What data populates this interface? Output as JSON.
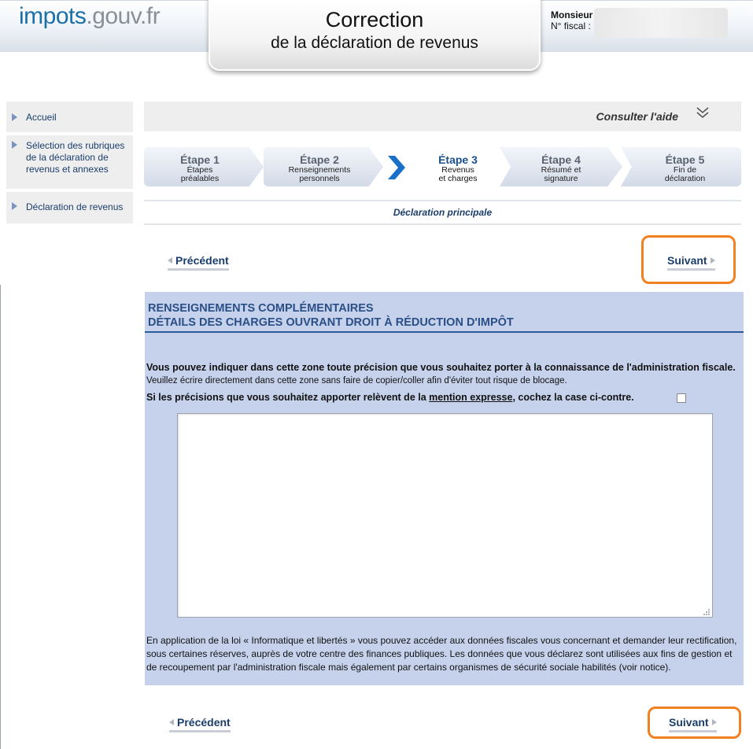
{
  "header": {
    "logo_part1": "impots",
    "logo_part2": ".gouv.fr",
    "title_line1": "Correction",
    "title_line2": "de la déclaration de revenus",
    "user_label": "Monsieur",
    "fiscal_label": "N° fiscal :"
  },
  "sidebar": {
    "items": [
      {
        "label": "Accueil"
      },
      {
        "label": "Sélection des rubriques de la déclaration de revenus et annexes"
      },
      {
        "label": "Déclaration de revenus"
      }
    ]
  },
  "help": {
    "label": "Consulter l'aide",
    "icon": "double-chevron-down-icon"
  },
  "steps": [
    {
      "number": "Étape 1",
      "line1": "Étapes",
      "line2": "préalables"
    },
    {
      "number": "Étape 2",
      "line1": "Renseignements",
      "line2": "personnels"
    },
    {
      "number": "Étape 3",
      "line1": "Revenus",
      "line2": "et charges"
    },
    {
      "number": "Étape 4",
      "line1": "Résumé et",
      "line2": "signature"
    },
    {
      "number": "Étape 5",
      "line1": "Fin de",
      "line2": "déclaration"
    }
  ],
  "active_step": 3,
  "declaration_label": "Déclaration principale",
  "nav": {
    "previous_label": "Précédent",
    "next_label": "Suivant"
  },
  "section": {
    "title_line1": "RENSEIGNEMENTS COMPLÉMENTAIRES",
    "title_line2": "DÉTAILS DES CHARGES OUVRANT DROIT À RÉDUCTION D'IMPÔT",
    "intro_bold": "Vous pouvez indiquer dans cette zone toute précision que vous souhaitez porter à la connaissance de l'administration fiscale.",
    "intro_normal": "Veuillez écrire directement dans cette zone sans faire de copier/coller afin d'éviter tout risque de blocage.",
    "mention_before": "Si les précisions que vous souhaitez apporter relèvent de la",
    "mention_link": "mention expresse",
    "mention_after": ", cochez la case ci-contre.",
    "textarea_value": "",
    "legal": "En application de la loi « Informatique et libertés » vous pouvez accéder aux données fiscales vous concernant et demander leur rectification, sous certaines réserves, auprès de votre centre des finances publiques. Les données que vous déclarez sont utilisées aux fins de gestion et de recoupement par l'administration fiscale mais également par certains organismes de sécurité sociale habilités (voir notice)."
  },
  "colors": {
    "highlight": "#f08020",
    "section_bg": "#c6d2ec",
    "title_blue": "#2a4f86",
    "active_arrow": "#1a6fc9"
  }
}
